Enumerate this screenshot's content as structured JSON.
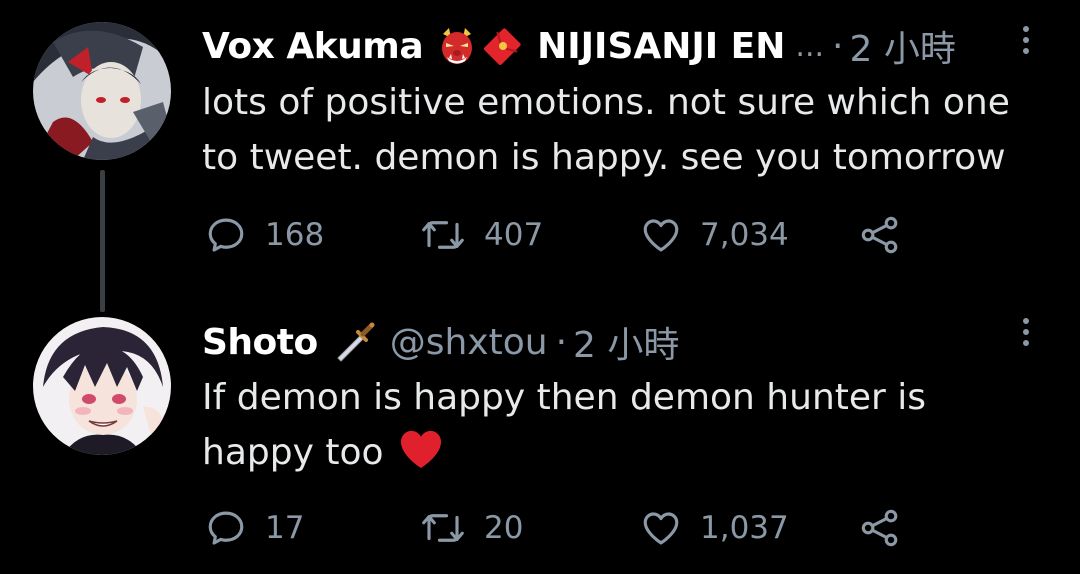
{
  "tweets": [
    {
      "author_name": "Vox Akuma",
      "author_emojis": [
        "oni-mask-emoji",
        "red-envelope-emoji"
      ],
      "handle": "NIJISANJI EN",
      "handle_truncation": "...",
      "separator": "·",
      "time": "2 小時",
      "text_lines": [
        "lots of positive emotions. not sure which one",
        "to tweet. demon is happy. see you tomorrow"
      ],
      "replies": "168",
      "retweets": "407",
      "likes": "7,034"
    },
    {
      "author_name": "Shoto",
      "author_emojis": [
        "dagger-emoji"
      ],
      "handle": "@shxtou",
      "separator": "·",
      "time": "2 小時",
      "text_lines": [
        "If demon is happy then demon hunter is",
        "happy too"
      ],
      "text_trailing_emoji": "red-heart-emoji",
      "replies": "17",
      "retweets": "20",
      "likes": "1,037"
    }
  ],
  "colors": {
    "background": "#000000",
    "primary_text": "#e7e9ea",
    "secondary_text": "#8b98a5",
    "thread_line": "#3a3f44",
    "heart_emoji": "#e0202d"
  },
  "icons": {
    "reply": "reply-icon",
    "retweet": "retweet-icon",
    "like": "like-icon",
    "share": "share-icon",
    "more": "more-options-icon"
  }
}
